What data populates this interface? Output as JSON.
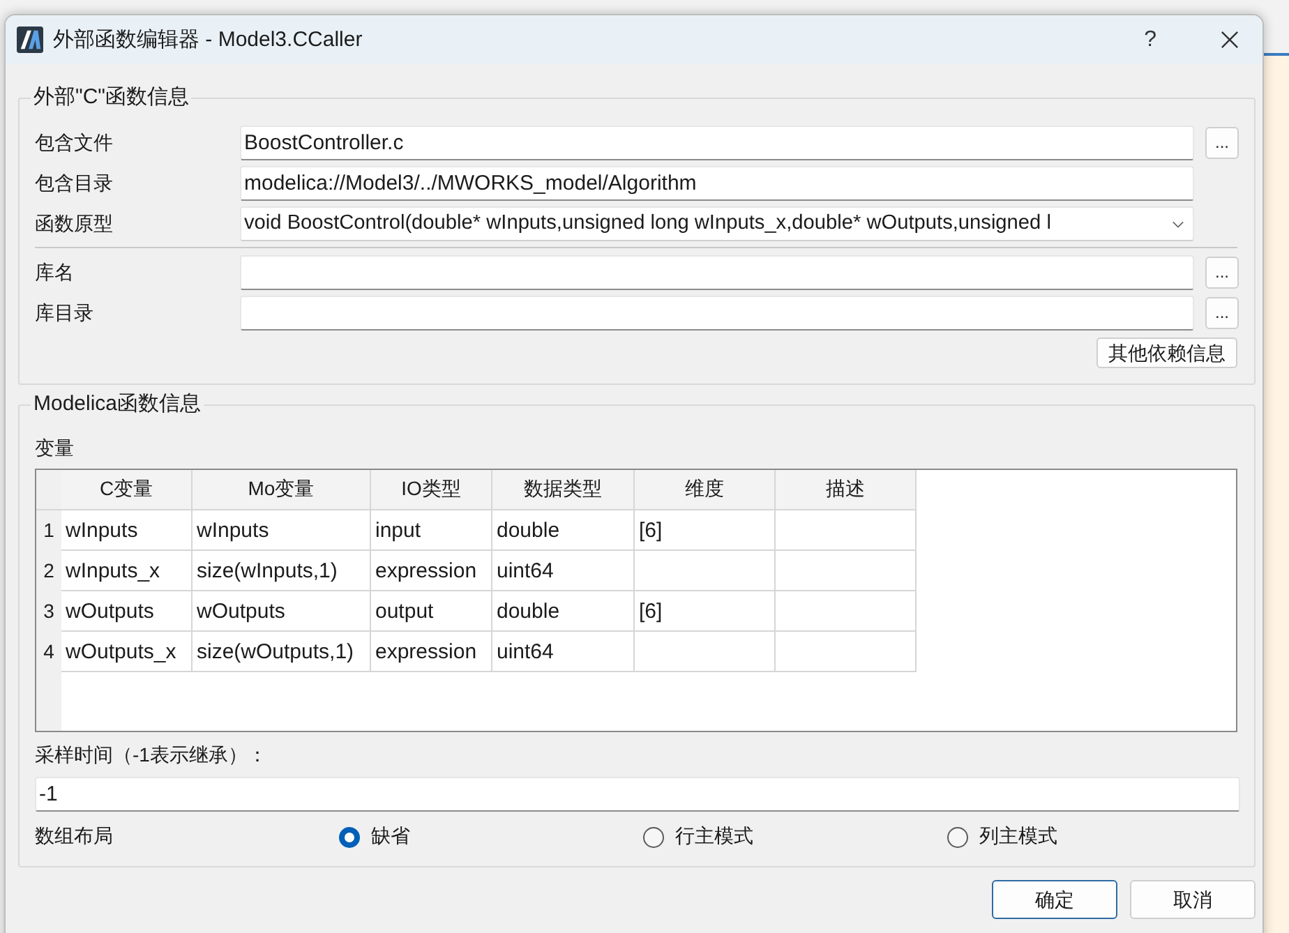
{
  "window": {
    "title": "外部函数编辑器 - Model3.CCaller",
    "help": "?"
  },
  "c_function_info": {
    "title": "外部\"C\"函数信息",
    "source_fields": [
      {
        "label": "包含文件",
        "kind": "browse",
        "value": "BoostController.c",
        "button": "..."
      },
      {
        "label": "包含目录",
        "kind": "text",
        "value": "modelica://Model3/../MWORKS_model/Algorithm"
      },
      {
        "label": "函数原型",
        "kind": "dropdown",
        "value": "void BoostControl(double* wInputs,unsigned long wInputs_x,double* wOutputs,unsigned l"
      }
    ],
    "library_fields": [
      {
        "label": "库名",
        "kind": "browse",
        "button": "..."
      },
      {
        "label": "库目录",
        "kind": "browse",
        "button": "..."
      }
    ],
    "other_dependencies_button": "其他依赖信息"
  },
  "modelica_function_info": {
    "title": "Modelica函数信息",
    "variables_label": "变量",
    "table": {
      "columns": [
        "C变量",
        "Mo变量",
        "IO类型",
        "数据类型",
        "维度",
        "描述"
      ],
      "rows": [
        {
          "number": "1",
          "c_var": "wInputs",
          "mo_var": "wInputs",
          "io_type": "input",
          "data_type": "double",
          "dimension": "[6]"
        },
        {
          "number": "2",
          "c_var": "wInputs_x",
          "mo_var": "size(wInputs,1)",
          "io_type": "expression",
          "data_type": "uint64"
        },
        {
          "number": "3",
          "c_var": "wOutputs",
          "mo_var": "wOutputs",
          "io_type": "output",
          "data_type": "double",
          "dimension": "[6]"
        },
        {
          "number": "4",
          "c_var": "wOutputs_x",
          "mo_var": "size(wOutputs,1)",
          "io_type": "expression",
          "data_type": "uint64"
        }
      ]
    },
    "sample_time": {
      "label": "采样时间（-1表示继承）：",
      "value": "-1"
    },
    "array_layout": {
      "label": "数组布局",
      "options": [
        {
          "label": "缺省",
          "selected": true
        },
        {
          "label": "行主模式",
          "selected": false
        },
        {
          "label": "列主模式",
          "selected": false
        }
      ]
    }
  },
  "buttons": [
    {
      "label": "确定",
      "default": true
    },
    {
      "label": "取消",
      "default": false
    }
  ]
}
